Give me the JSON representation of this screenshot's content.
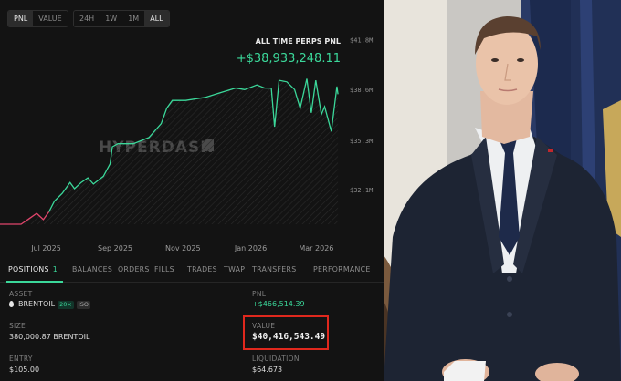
{
  "view_toggle": {
    "options": [
      "PNL",
      "VALUE"
    ],
    "selected": "PNL"
  },
  "range_toggle": {
    "options": [
      "24H",
      "1W",
      "1M",
      "ALL"
    ],
    "selected": "ALL"
  },
  "chart_header": {
    "title": "ALL TIME PERPS PNL",
    "value": "+$38,933,248.11"
  },
  "watermark": "HYPERDASH",
  "colors": {
    "up": "#3bd89a",
    "down": "#e0456b",
    "highlight": "#e0281d",
    "background": "#131313"
  },
  "chart_data": {
    "type": "line",
    "title": "ALL TIME PERPS PNL",
    "xlabel": "",
    "ylabel": "",
    "x_ticks": [
      "Jul 2025",
      "Sep 2025",
      "Nov 2025",
      "Jan 2026",
      "Mar 2026"
    ],
    "y_ticks": [
      "$41.8M",
      "$38.6M",
      "$35.3M",
      "$32.1M"
    ],
    "ylim": [
      29.9,
      41.8
    ],
    "grid": false,
    "series": [
      {
        "color_segments": "red below start, green above",
        "points": [
          [
            "2025-06-01",
            29.9
          ],
          [
            "2025-06-20",
            29.9
          ],
          [
            "2025-06-28",
            30.3
          ],
          [
            "2025-07-04",
            30.6
          ],
          [
            "2025-07-10",
            30.2
          ],
          [
            "2025-07-15",
            30.7
          ],
          [
            "2025-07-20",
            31.4
          ],
          [
            "2025-07-27",
            31.9
          ],
          [
            "2025-08-03",
            32.6
          ],
          [
            "2025-08-07",
            32.2
          ],
          [
            "2025-08-13",
            32.6
          ],
          [
            "2025-08-19",
            32.9
          ],
          [
            "2025-08-24",
            32.5
          ],
          [
            "2025-09-02",
            33.0
          ],
          [
            "2025-09-08",
            33.8
          ],
          [
            "2025-09-10",
            34.9
          ],
          [
            "2025-09-15",
            35.1
          ],
          [
            "2025-09-29",
            35.1
          ],
          [
            "2025-10-13",
            35.5
          ],
          [
            "2025-10-24",
            36.4
          ],
          [
            "2025-10-29",
            37.4
          ],
          [
            "2025-11-03",
            37.9
          ],
          [
            "2025-11-15",
            37.9
          ],
          [
            "2025-12-03",
            38.1
          ],
          [
            "2025-12-16",
            38.4
          ],
          [
            "2025-12-30",
            38.7
          ],
          [
            "2026-01-07",
            38.6
          ],
          [
            "2026-01-18",
            38.9
          ],
          [
            "2026-01-25",
            38.7
          ],
          [
            "2026-01-31",
            38.7
          ],
          [
            "2026-02-03",
            36.2
          ],
          [
            "2026-02-07",
            39.2
          ],
          [
            "2026-02-14",
            39.1
          ],
          [
            "2026-02-21",
            38.6
          ],
          [
            "2026-02-26",
            37.4
          ],
          [
            "2026-03-04",
            39.3
          ],
          [
            "2026-03-08",
            37.1
          ],
          [
            "2026-03-12",
            39.2
          ],
          [
            "2026-03-17",
            37.0
          ],
          [
            "2026-03-20",
            37.5
          ],
          [
            "2026-03-26",
            35.9
          ],
          [
            "2026-03-31",
            38.8
          ],
          [
            "2026-04-01",
            38.3
          ]
        ]
      }
    ]
  },
  "tabs": [
    {
      "label": "POSITIONS",
      "count": "1",
      "active": true
    },
    {
      "label": "BALANCES"
    },
    {
      "label": "ORDERS"
    },
    {
      "label": "FILLS"
    },
    {
      "label": "TRADES"
    },
    {
      "label": "TWAP"
    },
    {
      "label": "TRANSFERS"
    },
    {
      "label": "PERFORMANCE"
    }
  ],
  "position": {
    "asset_label": "ASSET",
    "asset": "BRENTOIL",
    "leverage": "20×",
    "margin_mode": "ISO",
    "pnl_label": "PNL",
    "pnl": "+$466,514.39",
    "size_label": "SIZE",
    "size": "380,000.87 BRENTOIL",
    "value_label": "VALUE",
    "value": "$40,416,543.49",
    "entry_label": "ENTRY",
    "entry": "$105.00",
    "liquidation_label": "LIQUIDATION",
    "liquidation": "$64.673"
  }
}
